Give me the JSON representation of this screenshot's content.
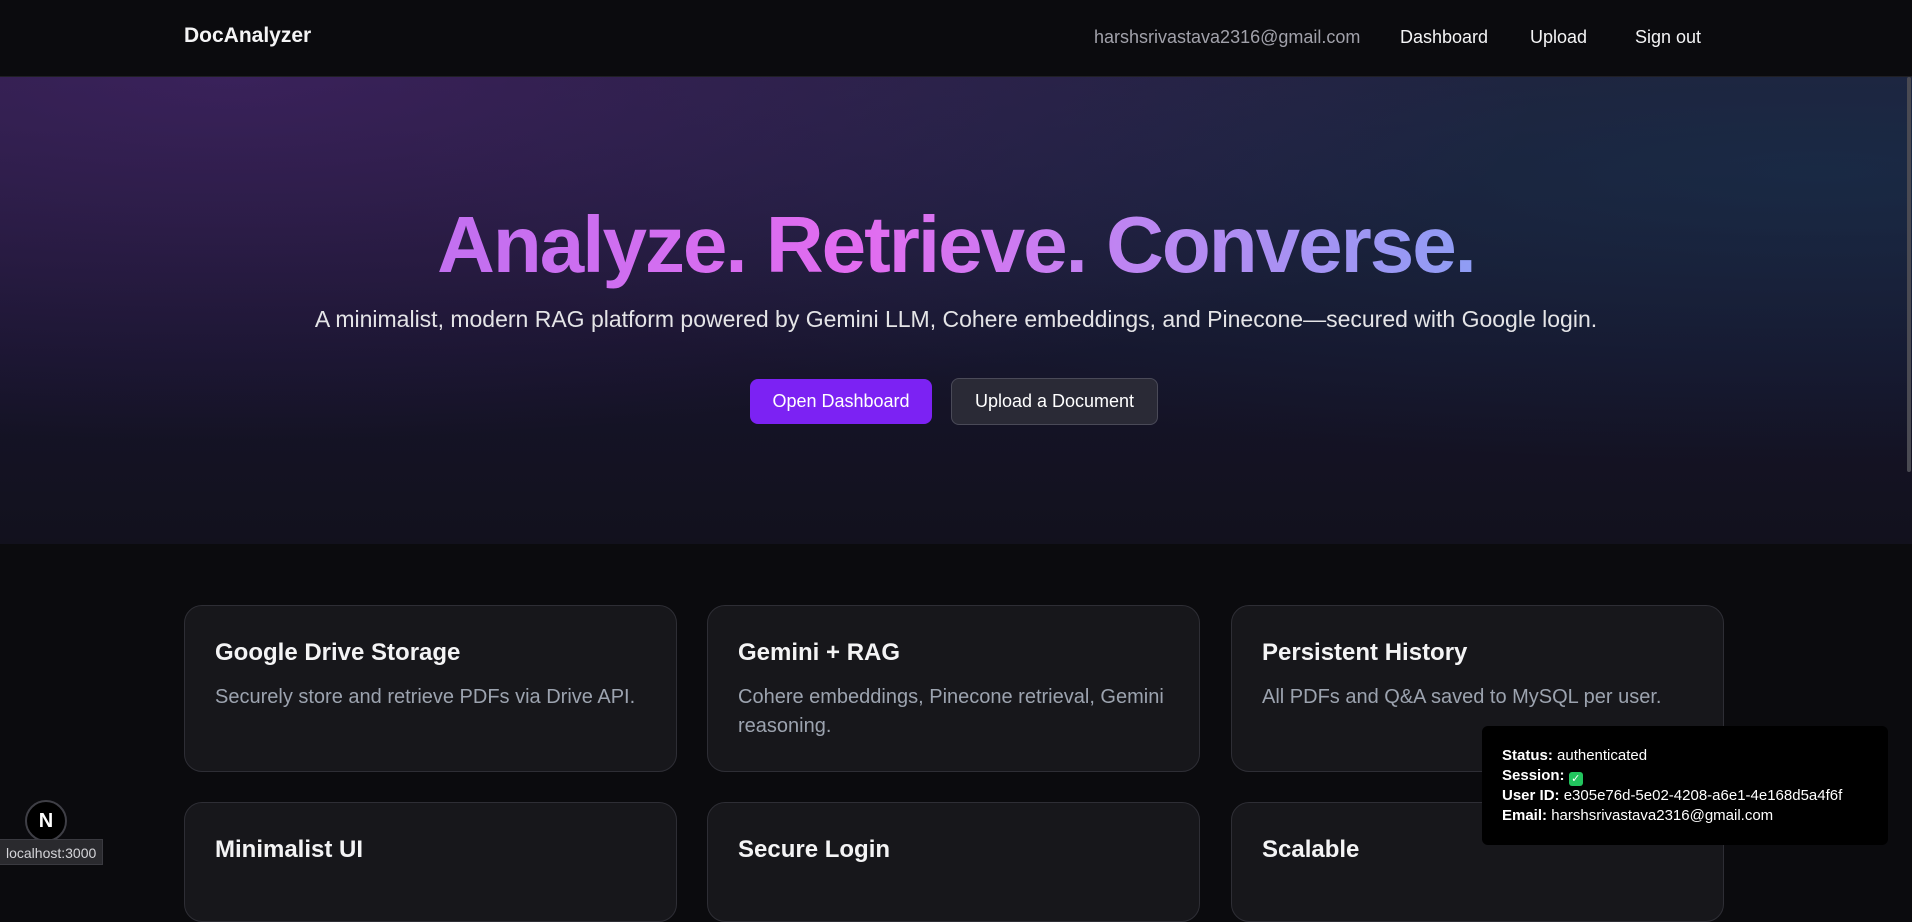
{
  "nav": {
    "brand": "DocAnalyzer",
    "email": "harshsrivastava2316@gmail.com",
    "dashboard": "Dashboard",
    "upload": "Upload",
    "signout": "Sign out"
  },
  "hero": {
    "title": "Analyze. Retrieve. Converse.",
    "subtitle": "A minimalist, modern RAG platform powered by Gemini LLM, Cohere embeddings, and Pinecone—secured with Google login.",
    "primary_button": "Open Dashboard",
    "secondary_button": "Upload a Document"
  },
  "features": [
    {
      "title": "Google Drive Storage",
      "desc": "Securely store and retrieve PDFs via Drive API."
    },
    {
      "title": "Gemini + RAG",
      "desc": "Cohere embeddings, Pinecone retrieval, Gemini reasoning."
    },
    {
      "title": "Persistent History",
      "desc": "All PDFs and Q&A saved to MySQL per user."
    },
    {
      "title": "Minimalist UI",
      "desc": ""
    },
    {
      "title": "Secure Login",
      "desc": ""
    },
    {
      "title": "Scalable",
      "desc": ""
    }
  ],
  "status_panel": {
    "status_label": "Status:",
    "status_value": "authenticated",
    "session_label": "Session:",
    "session_value": "✓",
    "userid_label": "User ID:",
    "userid_value": "e305e76d-5e02-4208-a6e1-4e168d5a4f6f",
    "email_label": "Email:",
    "email_value": "harshsrivastava2316@gmail.com"
  },
  "dev_badge": "N",
  "browser_status": "localhost:3000",
  "colors": {
    "primary_button": "#7c22f3",
    "background": "#0b0b0e",
    "card": "#17171b",
    "session_check": "#22c55e"
  }
}
